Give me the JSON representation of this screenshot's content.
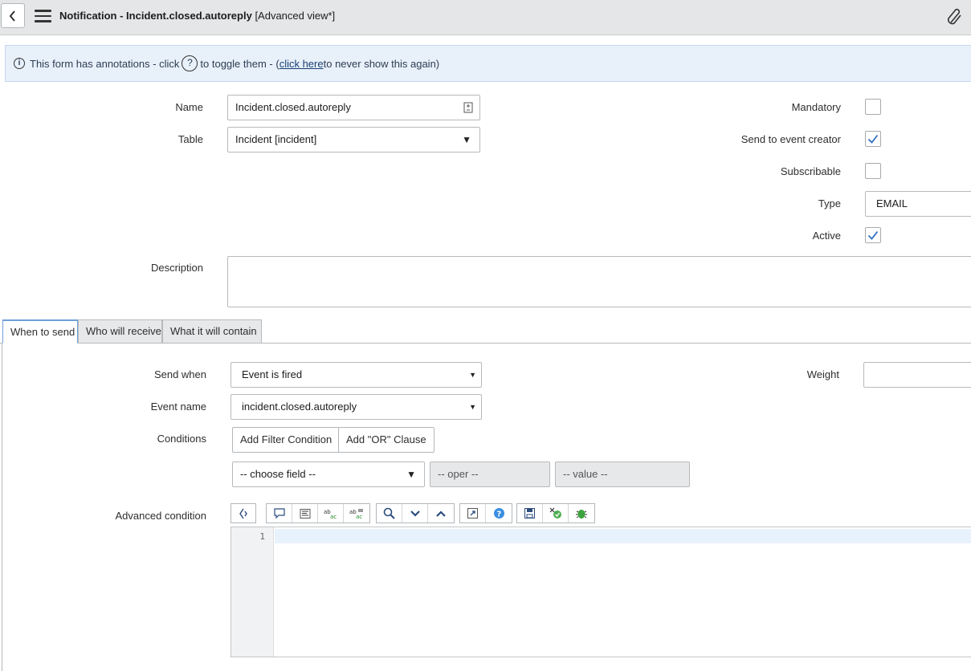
{
  "header": {
    "title": "Notification - Incident.closed.autoreply",
    "view": "[Advanced view*]"
  },
  "annotation": {
    "text1": "This form has annotations - click",
    "help_glyph": "?",
    "text2": "to toggle them - (",
    "link": "click here",
    "text3": " to never show this again)"
  },
  "form": {
    "name_label": "Name",
    "name_value": "Incident.closed.autoreply",
    "table_label": "Table",
    "table_value": "Incident [incident]",
    "mandatory_label": "Mandatory",
    "mandatory_checked": false,
    "send_to_creator_label": "Send to event creator",
    "send_to_creator_checked": true,
    "subscribable_label": "Subscribable",
    "subscribable_checked": false,
    "type_label": "Type",
    "type_value": "EMAIL",
    "active_label": "Active",
    "active_checked": true,
    "description_label": "Description",
    "description_value": ""
  },
  "tabs": [
    {
      "label": "When to send",
      "active": true
    },
    {
      "label": "Who will receive",
      "active": false
    },
    {
      "label": "What it will contain",
      "active": false
    }
  ],
  "when_to_send": {
    "send_when_label": "Send when",
    "send_when_value": "Event is fired",
    "event_name_label": "Event name",
    "event_name_value": "incident.closed.autoreply",
    "weight_label": "Weight",
    "weight_value": "",
    "conditions_label": "Conditions",
    "add_filter_label": "Add Filter Condition",
    "add_or_label": "Add \"OR\" Clause",
    "choose_field": "-- choose field --",
    "oper": "-- oper --",
    "value": "-- value --",
    "advanced_condition_label": "Advanced condition",
    "line_number": "1"
  },
  "colors": {
    "header_bg": "#e4e6e7",
    "annotation_bg": "#e8f0fa",
    "check_blue": "#2f6fbf",
    "active_tab_border": "#6e9fd9"
  }
}
